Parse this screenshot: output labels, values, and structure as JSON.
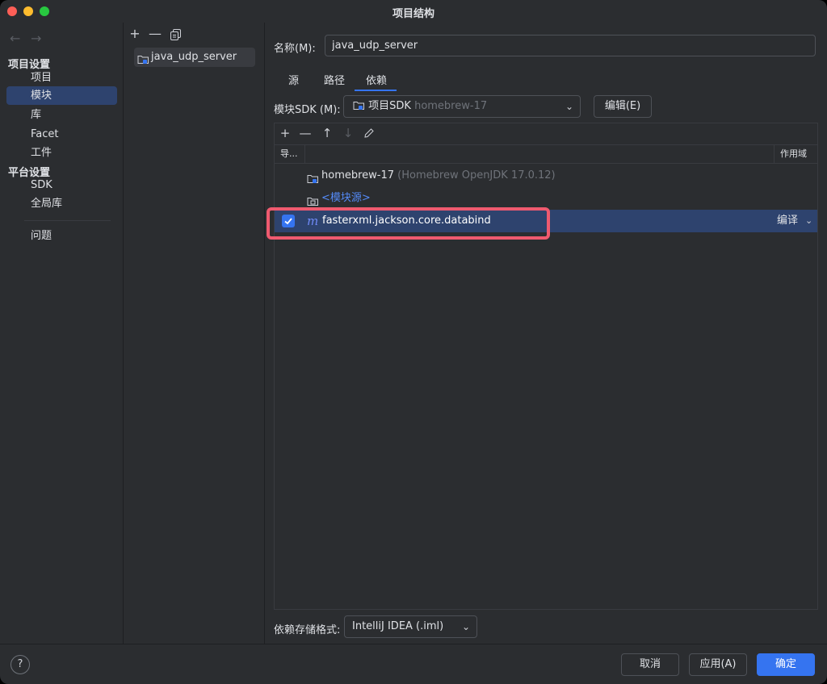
{
  "window": {
    "title": "项目结构"
  },
  "nav": {
    "back_icon": "←",
    "forward_icon": "→",
    "project_settings_header": "项目设置",
    "project_settings_items": [
      {
        "label": "项目"
      },
      {
        "label": "模块",
        "selected": true
      },
      {
        "label": "库"
      },
      {
        "label": "Facet"
      },
      {
        "label": "工件"
      }
    ],
    "platform_settings_header": "平台设置",
    "platform_settings_items": [
      {
        "label": "SDK"
      },
      {
        "label": "全局库"
      }
    ],
    "problems_label": "问题"
  },
  "modules": {
    "toolbar": {
      "add": "+",
      "remove": "—",
      "copy": "copy-icon"
    },
    "items": [
      {
        "name": "java_udp_server",
        "selected": true
      }
    ]
  },
  "module_detail": {
    "name_label": "名称(M):",
    "name_value": "java_udp_server",
    "tabs": [
      {
        "label": "源"
      },
      {
        "label": "路径"
      },
      {
        "label": "依赖",
        "active": true
      }
    ],
    "sdk_label": "模块SDK (M):",
    "sdk_value": "项目SDK",
    "sdk_value_detail": "homebrew-17",
    "edit_button": "编辑(E)",
    "dependencies": {
      "toolbar": {
        "add": "+",
        "remove": "—",
        "up": "↑",
        "down": "↓",
        "edit": "pencil-icon"
      },
      "columns": {
        "export": "导...",
        "scope": "作用域"
      },
      "rows": [
        {
          "name": "homebrew-17",
          "detail": "(Homebrew OpenJDK 17.0.12)",
          "icon": "sdk-folder-icon"
        },
        {
          "name": "<模块源>",
          "icon": "module-source-icon"
        },
        {
          "name": "fasterxml.jackson.core.databind",
          "icon": "maven-library-icon",
          "icon_glyph": "m",
          "exported": true,
          "scope": "编译",
          "selected": true
        }
      ]
    },
    "storage_label": "依赖存储格式:",
    "storage_value": "IntelliJ IDEA (.iml)"
  },
  "footer": {
    "help": "?",
    "cancel": "取消",
    "apply": "应用(A)",
    "ok": "确定"
  },
  "colors": {
    "accent": "#3574f0",
    "selection": "#2e436e",
    "highlight_annotation": "#ef5a6f"
  }
}
